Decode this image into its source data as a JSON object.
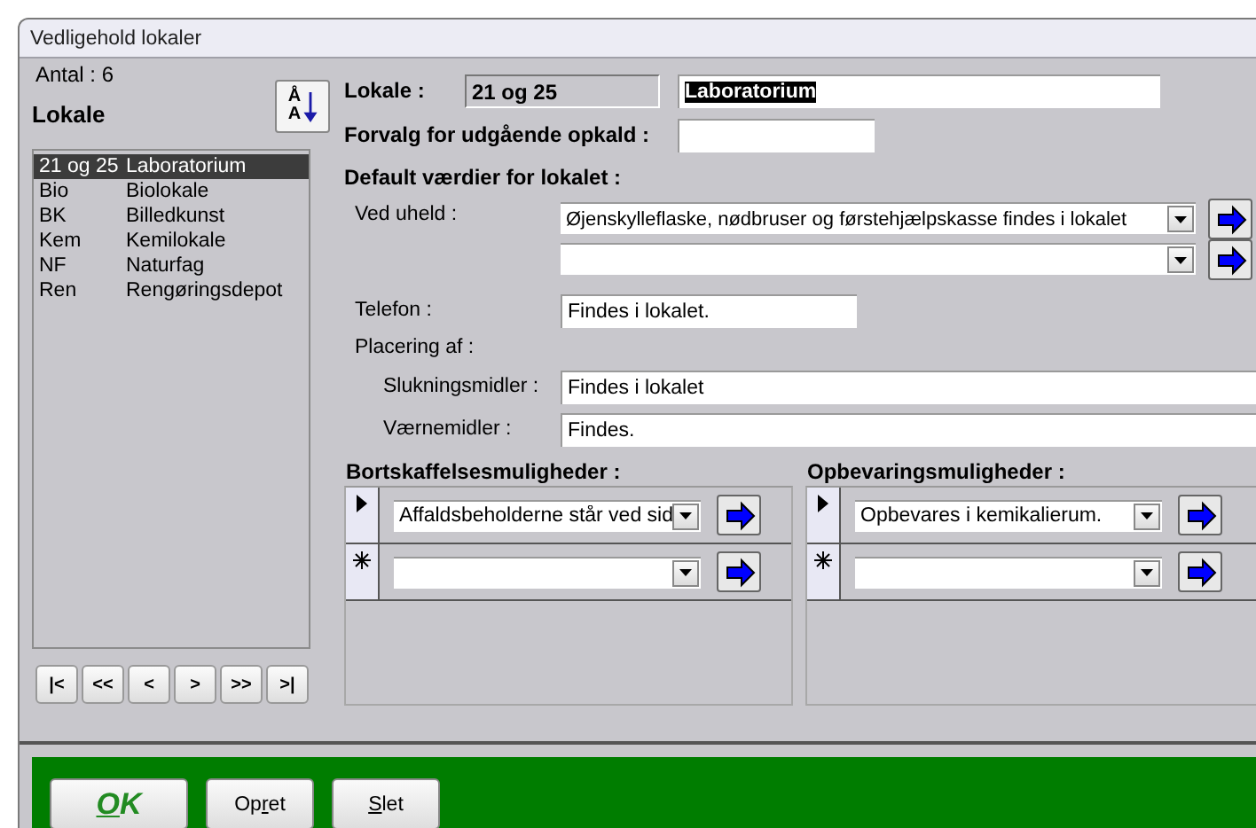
{
  "window": {
    "title": "Vedligehold lokaler"
  },
  "sidebar": {
    "count": "Antal : 6",
    "heading": "Lokale",
    "sort_button": {
      "top": "Å",
      "bottom": "A"
    },
    "items": [
      {
        "code": "21 og 25",
        "name": "Laboratorium",
        "selected": true
      },
      {
        "code": "Bio",
        "name": "Biolokale",
        "selected": false
      },
      {
        "code": "BK",
        "name": "Billedkunst",
        "selected": false
      },
      {
        "code": "Kem",
        "name": "Kemilokale",
        "selected": false
      },
      {
        "code": "NF",
        "name": "Naturfag",
        "selected": false
      },
      {
        "code": "Ren",
        "name": "Rengøringsdepot",
        "selected": false
      }
    ],
    "nav_buttons": [
      "|<",
      "<<",
      "<",
      ">",
      ">>",
      ">|"
    ]
  },
  "form": {
    "lokale_label": "Lokale :",
    "code": "21 og 25",
    "name": {
      "value": "Laboratorium",
      "selected": true
    },
    "forvalg_label": "Forvalg for udgående opkald :",
    "defaults_heading": "Default værdier for lokalet :",
    "ved_uheld": {
      "label": "Ved uheld :",
      "combos": [
        {
          "kind": "filled",
          "value": "Øjenskylleflaske, nødbruser og førstehjælpskasse findes i lokalet"
        },
        {
          "kind": "empty"
        }
      ]
    },
    "telefon": {
      "label": "Telefon :",
      "value": "Findes i lokalet."
    },
    "placering_label": "Placering af :",
    "slukningsmidler": {
      "label": "Slukningsmidler :",
      "value": "Findes i lokalet"
    },
    "vaernemidler": {
      "label": "Værnemidler :",
      "value": "Findes."
    }
  },
  "subforms": [
    {
      "title": "Bortskaffelsesmuligheder :",
      "rows": [
        {
          "kind": "current",
          "value": "Affaldsbeholderne står ved sid"
        },
        {
          "kind": "new"
        }
      ]
    },
    {
      "title": "Opbevaringsmuligheder :",
      "rows": [
        {
          "kind": "current",
          "value": "Opbevares i kemikalierum."
        },
        {
          "kind": "new"
        }
      ]
    }
  ],
  "footer_buttons": [
    {
      "kind": "default",
      "key": "O",
      "rest": "K"
    },
    {
      "kind": "normal",
      "lead": "Op",
      "key": "r",
      "rest": "et"
    },
    {
      "kind": "normal",
      "key": "S",
      "rest": "let"
    }
  ]
}
